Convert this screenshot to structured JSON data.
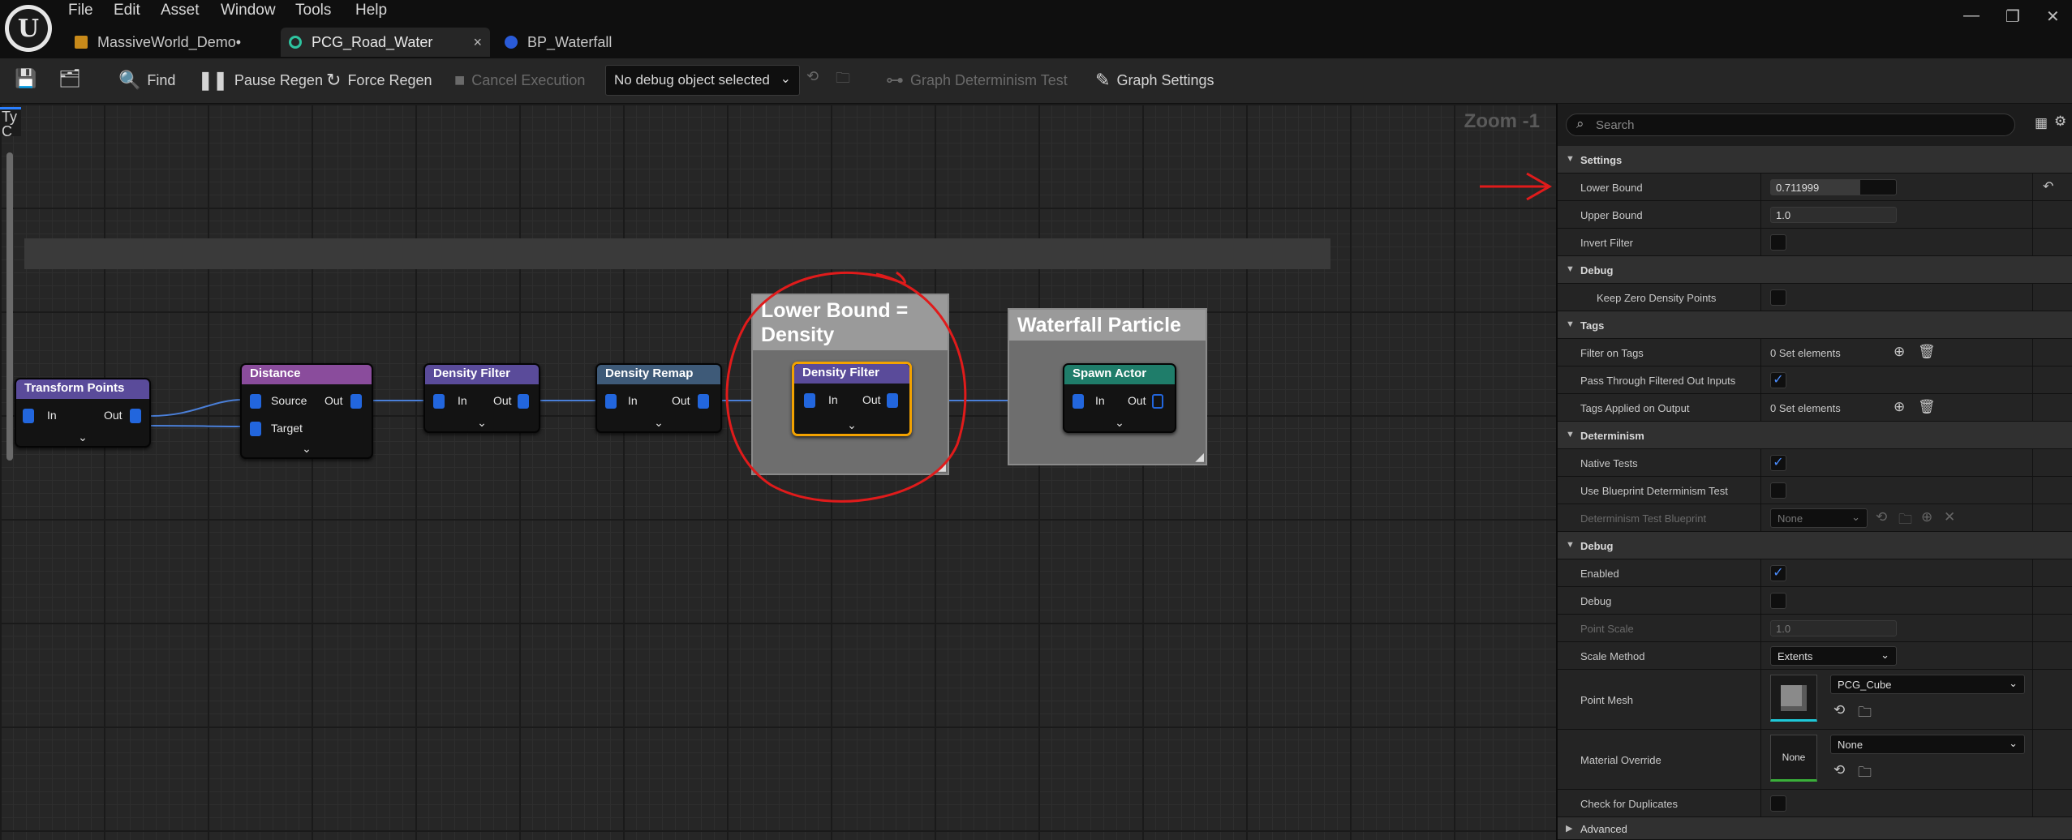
{
  "menu": [
    "File",
    "Edit",
    "Asset",
    "Window",
    "Tools",
    "Help"
  ],
  "tabs": [
    {
      "label": "MassiveWorld_Demo•",
      "active": false
    },
    {
      "label": "PCG_Road_Water",
      "active": true
    },
    {
      "label": "BP_Waterfall",
      "active": false
    }
  ],
  "toolbar": {
    "find": "Find",
    "pause_regen": "Pause Regen",
    "force_regen": "Force Regen",
    "cancel_execution": "Cancel Execution",
    "debug_object": "No debug object selected",
    "graph_determinism_test": "Graph Determinism Test",
    "graph_settings": "Graph Settings"
  },
  "graph": {
    "zoom": "Zoom -1",
    "left_clip_label": "Ty\nC",
    "comments": [
      {
        "title": "Lower Bound = Density"
      },
      {
        "title": "Waterfall Particle"
      }
    ],
    "nodes": {
      "transform_points": {
        "title": "Transform Points",
        "in": "In",
        "out": "Out"
      },
      "distance": {
        "title": "Distance",
        "source": "Source",
        "target": "Target",
        "out": "Out"
      },
      "density_filter_1": {
        "title": "Density Filter",
        "in": "In",
        "out": "Out"
      },
      "density_remap": {
        "title": "Density Remap",
        "in": "In",
        "out": "Out"
      },
      "density_filter_2": {
        "title": "Density Filter",
        "in": "In",
        "out": "Out"
      },
      "spawn_actor": {
        "title": "Spawn Actor",
        "in": "In",
        "out": "Out"
      }
    }
  },
  "details": {
    "search_placeholder": "Search",
    "settings": {
      "header": "Settings",
      "lower_bound_label": "Lower Bound",
      "lower_bound": "0.711999",
      "lower_bound_fraction": 0.712,
      "upper_bound_label": "Upper Bound",
      "upper_bound": "1.0",
      "invert_filter_label": "Invert Filter",
      "invert_filter": false
    },
    "debug_section": {
      "header": "Debug",
      "keep_zero_label": "Keep Zero Density Points",
      "keep_zero": false
    },
    "tags": {
      "header": "Tags",
      "filter_on_tags_label": "Filter on Tags",
      "filter_on_tags": "0 Set elements",
      "pass_through_label": "Pass Through Filtered Out Inputs",
      "pass_through": true,
      "tags_applied_label": "Tags Applied on Output",
      "tags_applied": "0 Set elements"
    },
    "determinism": {
      "header": "Determinism",
      "native_tests_label": "Native Tests",
      "native_tests": true,
      "use_bp_label": "Use Blueprint Determinism Test",
      "use_bp": false,
      "test_bp_label": "Determinism Test Blueprint",
      "test_bp": "None"
    },
    "debug": {
      "header": "Debug",
      "enabled_label": "Enabled",
      "enabled": true,
      "debug_label": "Debug",
      "debug": false,
      "point_scale_label": "Point Scale",
      "point_scale": "1.0",
      "scale_method_label": "Scale Method",
      "scale_method": "Extents",
      "point_mesh_label": "Point Mesh",
      "point_mesh": "PCG_Cube",
      "material_override_label": "Material Override",
      "material_override": "None",
      "material_thumb": "None",
      "check_dup_label": "Check for Duplicates",
      "check_dup": false
    },
    "advanced": "Advanced"
  },
  "colors": {
    "accent": "#f3a200",
    "annotation": "#e01b1b",
    "pin": "#2266dd",
    "distance_header": "#8a4c9c",
    "density_filter_header": "#5a4b9a",
    "density_remap_header": "#3e5a78",
    "spawn_actor_header": "#1f7d6a"
  }
}
